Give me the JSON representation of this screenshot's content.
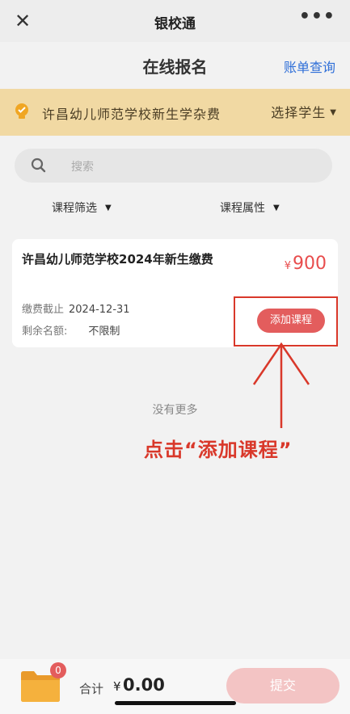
{
  "topbar": {
    "title": "银校通",
    "close_glyph": "✕",
    "more_glyph": "•••"
  },
  "header": {
    "title": "在线报名",
    "bill_link": "账单查询"
  },
  "school_bar": {
    "name": "许昌幼儿师范学校新生学杂费",
    "select_label": "选择学生",
    "caret": "▼",
    "icon": "bulb-icon"
  },
  "search": {
    "placeholder": "搜索",
    "icon": "search-icon"
  },
  "filters": {
    "course": {
      "label": "课程筛选",
      "caret": "▼"
    },
    "attribute": {
      "label": "课程属性",
      "caret": "▼"
    }
  },
  "course_card": {
    "title": "许昌幼儿师范学校2024年新生缴费",
    "currency": "¥",
    "price": "900",
    "deadline_label": "缴费截止",
    "deadline_value": "2024-12-31",
    "quota_label": "剩余名额:",
    "quota_value": "不限制",
    "add_button": "添加课程"
  },
  "list": {
    "end_text": "没有更多"
  },
  "annotation": {
    "instruction": "点击“添加课程”",
    "color": "#d9382a"
  },
  "bottom_bar": {
    "cart_count": "0",
    "total_label": "合计",
    "currency": "¥",
    "total_amount": "0.00",
    "submit_label": "提交"
  },
  "colors": {
    "accent_red": "#e35d5d",
    "link_blue": "#2f6fd8",
    "banner_bg": "#f1d9a3"
  }
}
